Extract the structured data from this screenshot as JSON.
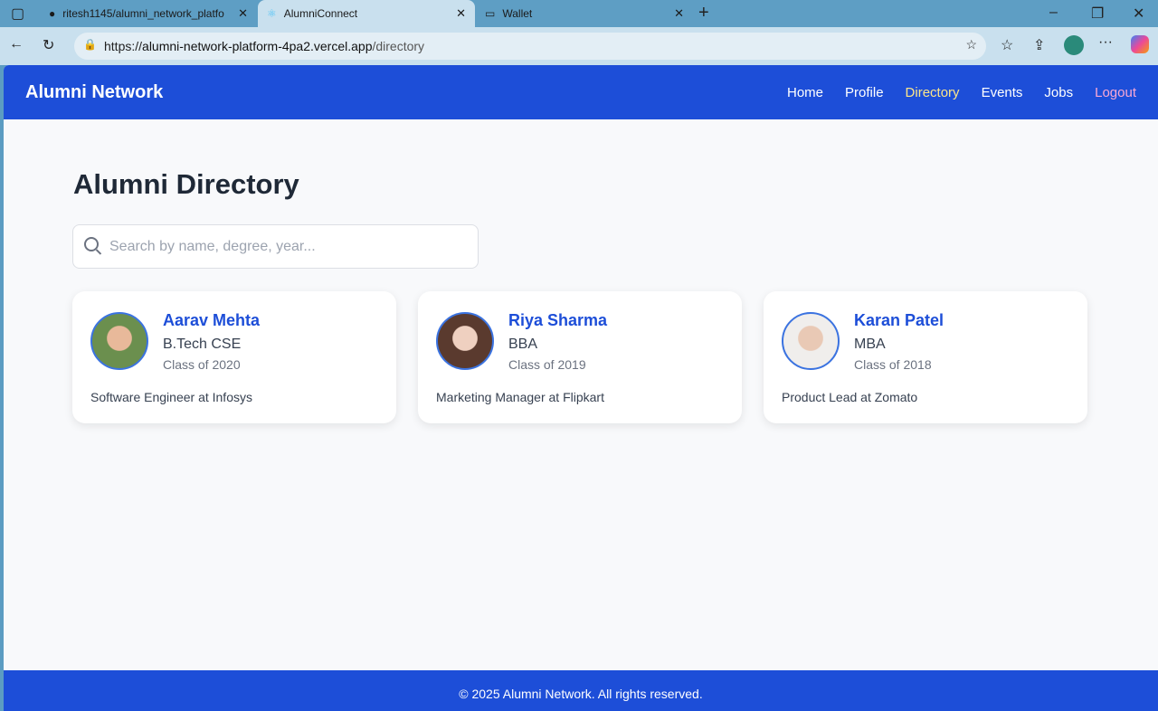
{
  "browser": {
    "tabs": [
      {
        "label": "ritesh1145/alumni_network_platfo"
      },
      {
        "label": "AlumniConnect"
      },
      {
        "label": "Wallet"
      }
    ],
    "url_prefix": "https://",
    "url_host": "alumni-network-platform-4pa2.vercel.app",
    "url_path": "/directory"
  },
  "nav": {
    "brand": "Alumni Network",
    "links": [
      "Home",
      "Profile",
      "Directory",
      "Events",
      "Jobs",
      "Logout"
    ],
    "active": "Directory"
  },
  "main": {
    "title": "Alumni Directory",
    "search_placeholder": "Search by name, degree, year...",
    "alumni": [
      {
        "name": "Aarav Mehta",
        "degree": "B.Tech CSE",
        "year": "Class of 2020",
        "job": "Software Engineer at Infosys",
        "avatar_color": "#6b8f4e"
      },
      {
        "name": "Riya Sharma",
        "degree": "BBA",
        "year": "Class of 2019",
        "job": "Marketing Manager at Flipkart",
        "avatar_color": "#8a6a5a"
      },
      {
        "name": "Karan Patel",
        "degree": "MBA",
        "year": "Class of 2018",
        "job": "Product Lead at Zomato",
        "avatar_color": "#d8d4cf"
      }
    ]
  },
  "footer": {
    "text": "© 2025 Alumni Network. All rights reserved."
  }
}
